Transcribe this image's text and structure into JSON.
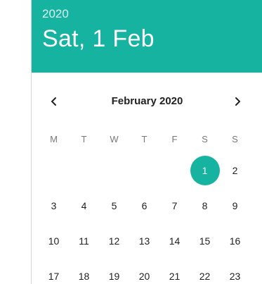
{
  "header": {
    "year": "2020",
    "selected_date": "Sat, 1 Feb"
  },
  "calendar": {
    "month_label": "February 2020",
    "prev_icon": "chevron-left-icon",
    "next_icon": "chevron-right-icon",
    "weekdays": [
      "M",
      "T",
      "W",
      "T",
      "F",
      "S",
      "S"
    ],
    "leading_blanks": 5,
    "days": [
      "1",
      "2",
      "3",
      "4",
      "5",
      "6",
      "7",
      "8",
      "9",
      "10",
      "11",
      "12",
      "13",
      "14",
      "15",
      "16",
      "17",
      "18",
      "19",
      "20",
      "21",
      "22",
      "23"
    ],
    "selected_day": "1"
  },
  "colors": {
    "accent": "#16b3a0",
    "header_text": "#ffffff",
    "weekday_text": "#7a7a7a",
    "day_text": "#222222"
  }
}
